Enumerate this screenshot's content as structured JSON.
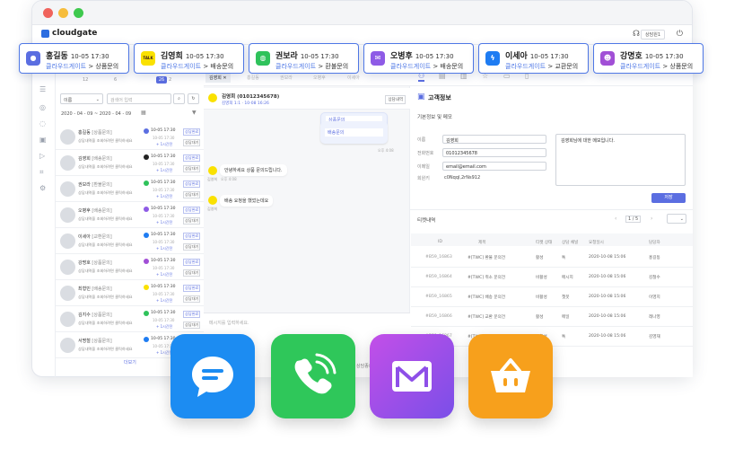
{
  "app": {
    "logo": "cloudgate",
    "user_chip": "상담원1"
  },
  "cards": [
    {
      "name": "홍길동",
      "time": "10-05 17:30",
      "source": "클라우드게이트",
      "category": "상품문의",
      "channel": "chat",
      "color": "#5b6ee1"
    },
    {
      "name": "김영희",
      "time": "10-05 17:30",
      "source": "클라우드게이트",
      "category": "배송문의",
      "channel": "kakao",
      "color": "#fae100"
    },
    {
      "name": "권보라",
      "time": "10-05 17:30",
      "source": "클라우드게이트",
      "category": "환불문의",
      "channel": "line",
      "color": "#2fc25b"
    },
    {
      "name": "오병후",
      "time": "10-05 17:30",
      "source": "클라우드게이트",
      "category": "배송문의",
      "channel": "mail",
      "color": "#8e5be6"
    },
    {
      "name": "이세아",
      "time": "10-05 17:30",
      "source": "클라우드게이트",
      "category": "교환문의",
      "channel": "messenger",
      "color": "#1e7cf2"
    },
    {
      "name": "강명호",
      "time": "10-05 17:30",
      "source": "클라우드게이트",
      "category": "상품문의",
      "channel": "chatbot",
      "color": "#a14fd6"
    }
  ],
  "list": {
    "tabs": [
      "12",
      "6",
      "2",
      "26"
    ],
    "filter_select": "이름",
    "search_placeholder": "검색어 입력",
    "date_range": "2020 - 04 - 09  ~  2020 - 04 - 09",
    "rows": [
      {
        "name": "홍길동",
        "category": "[상품문의]",
        "message": "상담내역을 조회하려면 클릭하세요",
        "time": "10-05 17:30",
        "sub": "10-05 17:30",
        "extra": "+ 1시간전",
        "status": "상담완료",
        "wait": "상담대기",
        "channel_color": "#5b6ee1"
      },
      {
        "name": "김영희",
        "category": "[배송문의]",
        "message": "상담내역을 조회하려면 클릭하세요",
        "time": "10-05 17:30",
        "sub": "10-05 17:30",
        "extra": "+ 1시간전",
        "status": "상담완료",
        "wait": "상담대기",
        "channel_color": "#222"
      },
      {
        "name": "권보라",
        "category": "[환불문의]",
        "message": "상담내역을 조회하려면 클릭하세요",
        "time": "10-05 17:30",
        "sub": "10-05 17:30",
        "extra": "+ 1시간전",
        "status": "상담완료",
        "wait": "상담대기",
        "channel_color": "#2fc25b"
      },
      {
        "name": "오병후",
        "category": "[배송문의]",
        "message": "상담내역을 조회하려면 클릭하세요",
        "time": "10-05 17:30",
        "sub": "10-05 17:30",
        "extra": "+ 1시간전",
        "status": "상담완료",
        "wait": "상담대기",
        "channel_color": "#8e5be6"
      },
      {
        "name": "이세아",
        "category": "[교환문의]",
        "message": "상담내역을 조회하려면 클릭하세요",
        "time": "10-05 17:30",
        "sub": "10-05 17:30",
        "extra": "+ 1시간전",
        "status": "상담완료",
        "wait": "상담대기",
        "channel_color": "#1e7cf2"
      },
      {
        "name": "강명호",
        "category": "[상품문의]",
        "message": "상담내역을 조회하려면 클릭하세요",
        "time": "10-05 17:30",
        "sub": "10-05 17:30",
        "extra": "+ 1시간전",
        "status": "상담완료",
        "wait": "상담대기",
        "channel_color": "#a14fd6"
      },
      {
        "name": "최형민",
        "category": "[배송문의]",
        "message": "상담내역을 조회하려면 클릭하세요",
        "time": "10-05 17:30",
        "sub": "10-05 17:30",
        "extra": "+ 1시간전",
        "status": "상담완료",
        "wait": "상담대기",
        "channel_color": "#fae100"
      },
      {
        "name": "김지수",
        "category": "[상품문의]",
        "message": "상담내역을 조회하려면 클릭하세요",
        "time": "10-05 17:30",
        "sub": "10-05 17:30",
        "extra": "+ 1시간전",
        "status": "상담완료",
        "wait": "상담대기",
        "channel_color": "#2fc25b"
      },
      {
        "name": "서명철",
        "category": "[상품문의]",
        "message": "상담내역을 조회하려면 클릭하세요",
        "time": "10-05 17:30",
        "sub": "10-05 17:30",
        "extra": "+ 1시간전",
        "status": "상담완료",
        "wait": "상담대기",
        "channel_color": "#1e7cf2"
      }
    ],
    "more": "더보기"
  },
  "chat": {
    "tabs": [
      "김영희",
      "홍길동",
      "권보라",
      "오병후",
      "이세아"
    ],
    "header_name": "김영희 (01012345678)",
    "header_sub": "김영희 1:1 · 10-08 16:26",
    "header_btn": "상담내역",
    "msg1": "상품문의",
    "msg2": "배송문의",
    "msg3": "안녕하세요 상품 문의드립니다.",
    "msg4": "배송 요청을 했었는데요",
    "name_small": "김영희",
    "time_small": "오후 4:08",
    "input_placeholder": "메시지를 입력하세요.",
    "send_label": "상담종료"
  },
  "info": {
    "title": "고객정보",
    "section": "기본정보 및 메모",
    "fields": [
      {
        "label": "이름",
        "value": "김영희"
      },
      {
        "label": "전화번호",
        "value": "01012345678"
      },
      {
        "label": "이메일",
        "value": "email@email.com"
      },
      {
        "label": "회원키",
        "value": "c0Nqql,2rNs912"
      }
    ],
    "memo": "김영희님에 대한 메모입니다.",
    "save_label": "저장",
    "history_title": "티켓내역",
    "pagination": "1 / 5",
    "columns": [
      "ID",
      "제목",
      "티켓 상태",
      "상담 채널",
      "요청일시",
      "담당자"
    ],
    "rows": [
      [
        "#B59_16863",
        "#[TWC] 환불 문의건",
        "활성",
        "톡",
        "2020-10-08 15:06",
        "홍길동"
      ],
      [
        "#B59_16864",
        "#[TWC] 취소 문의건",
        "비활성",
        "메시지",
        "2020-10-08 15:06",
        "김철수"
      ],
      [
        "#B59_16865",
        "#[TWC] 배송 문의건",
        "비활성",
        "챗봇",
        "2020-10-08 15:06",
        "이영지"
      ],
      [
        "#B59_16866",
        "#[TWC] 교환 문의건",
        "활성",
        "메일",
        "2020-10-08 15:06",
        "레나영"
      ],
      [
        "#B59_16867",
        "#[TWC] 제품 문의건",
        "비활성",
        "톡",
        "2020-10-08 15:06",
        "김영재"
      ]
    ]
  },
  "tiles": [
    {
      "name": "chat-tile",
      "color": "#1c8cf2"
    },
    {
      "name": "call-tile",
      "color": "#2fc75a"
    },
    {
      "name": "mail-tile",
      "color": "#9b4fe8"
    },
    {
      "name": "shop-tile",
      "color": "#f7a01c"
    }
  ]
}
